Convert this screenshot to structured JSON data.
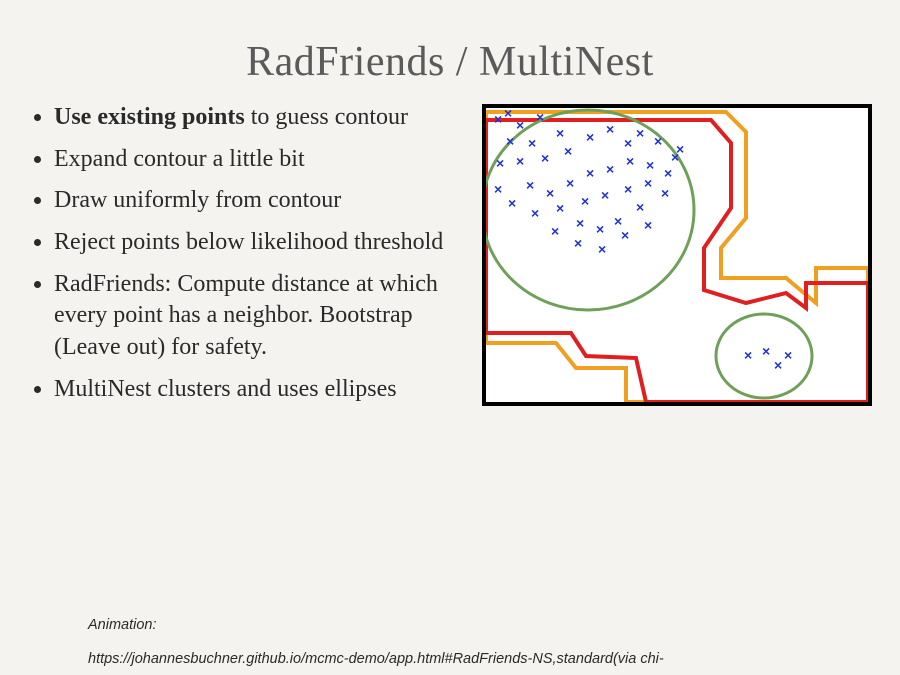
{
  "title": "RadFriends / MultiNest",
  "bullets": {
    "item0_bold": "Use existing points",
    "item0_rest": " to guess contour",
    "item1": "Expand contour a little bit",
    "item2": "Draw uniformly from contour",
    "item3": "Reject points below likelihood threshold",
    "item4": "RadFriends: Compute distance at which every point has a neighbor. Bootstrap (Leave out) for safety.",
    "item5": "MultiNest clusters and uses ellipses"
  },
  "footer": {
    "animation_label": "Animation:",
    "url": "https://johannesbuchner.github.io/mcmc-demo/app.html#RadFriends-NS,standard(via chi-"
  },
  "figure": {
    "colors": {
      "points": "#2030d8",
      "green": "#6fa05a",
      "red": "#e02020",
      "orange": "#f0a020"
    }
  }
}
